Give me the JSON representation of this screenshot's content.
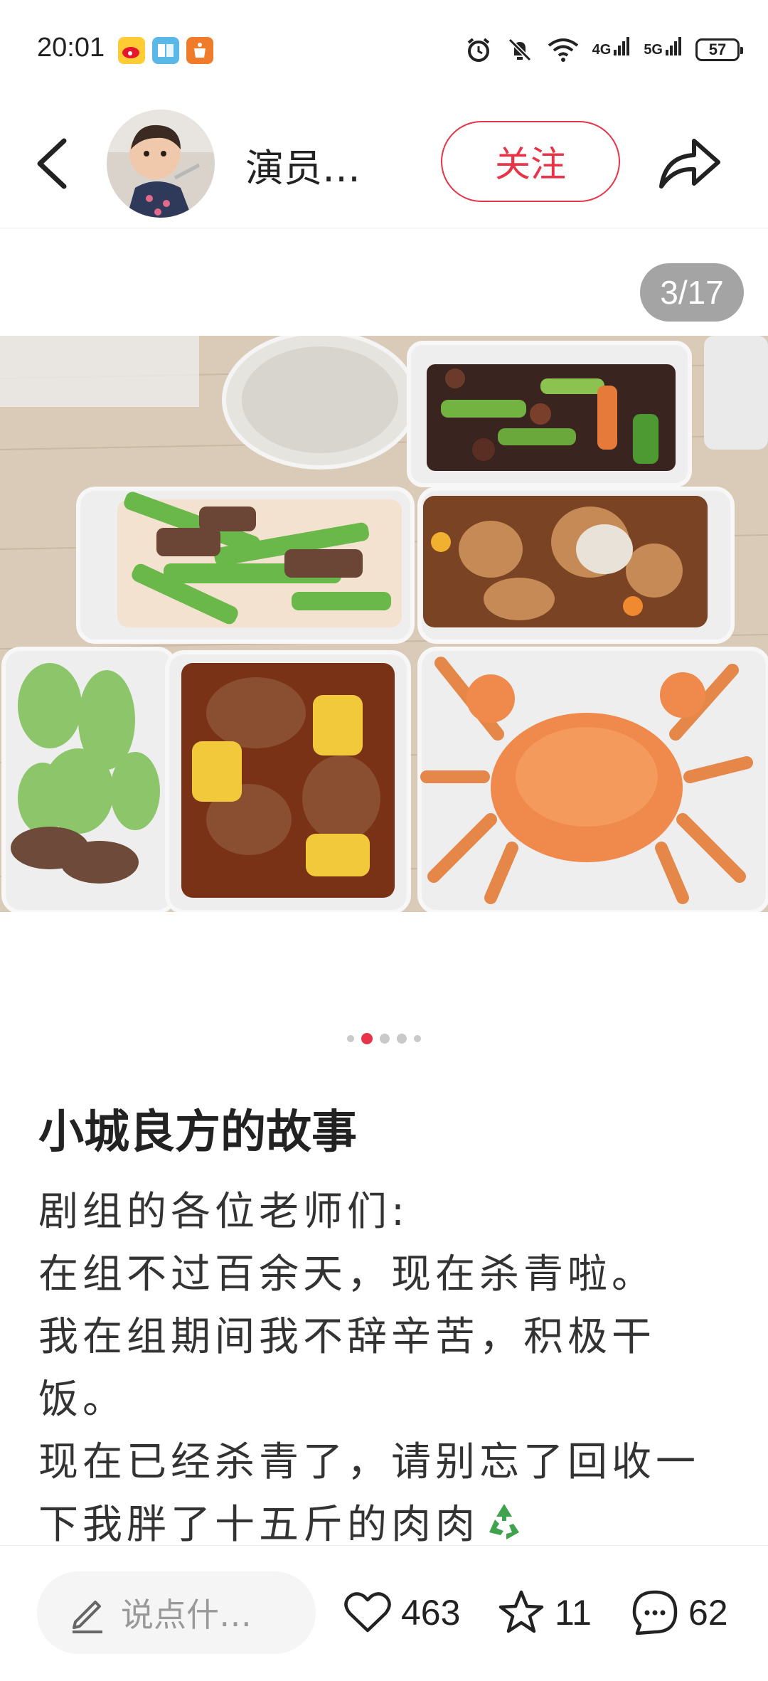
{
  "status_bar": {
    "time": "20:01",
    "app_icons": [
      "weibo-icon",
      "reader-icon",
      "shop-icon"
    ],
    "network_1": "4G",
    "network_2": "5G",
    "battery": "57"
  },
  "header": {
    "username": "演员…",
    "follow_label": "关注"
  },
  "gallery": {
    "counter": "3/17",
    "dot_count": 5,
    "active_dot": 1
  },
  "post": {
    "title": "小城良方的故事",
    "lines": [
      "剧组的各位老师们:",
      "在组不过百余天，现在杀青啦。",
      "我在组期间我不辞辛苦，积极干饭。",
      "现在已经杀青了，请别忘了回收一下我胖了十五斤的肉肉"
    ]
  },
  "bottom_bar": {
    "comment_placeholder": "说点什…",
    "likes": "463",
    "favorites": "11",
    "comments": "62"
  },
  "colors": {
    "accent": "#e73449",
    "text": "#222222",
    "muted": "#999999"
  }
}
